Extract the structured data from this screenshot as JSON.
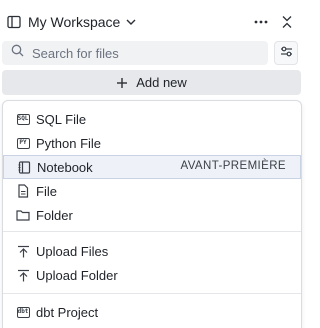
{
  "header": {
    "workspace_title": "My Workspace",
    "workspace_icon": "sidebar-panel-icon",
    "more_icon": "more-horizontal-icon",
    "collapse_icon": "collapse-icon"
  },
  "search": {
    "placeholder": "Search for files",
    "value": ""
  },
  "filter_icon": "filter-settings-icon",
  "add_new": {
    "label": "Add new",
    "icon": "plus-icon"
  },
  "menu": {
    "items": [
      {
        "label": "SQL File",
        "icon": "sql-file-icon",
        "icon_text": "SQL"
      },
      {
        "label": "Python File",
        "icon": "python-file-icon",
        "icon_text": "PY"
      },
      {
        "label": "Notebook",
        "icon": "notebook-icon",
        "badge": "AVANT-PREMIÈRE"
      },
      {
        "label": "File",
        "icon": "file-icon"
      },
      {
        "label": "Folder",
        "icon": "folder-icon"
      },
      {
        "label": "Upload Files",
        "icon": "upload-icon"
      },
      {
        "label": "Upload Folder",
        "icon": "upload-icon"
      },
      {
        "label": "dbt Project",
        "icon": "dbt-project-icon",
        "icon_text": "dbt"
      }
    ]
  },
  "colors": {
    "active_row_bg": "#eef2f8",
    "search_bg": "#f1f2f4",
    "button_bg": "#e6e8eb"
  }
}
